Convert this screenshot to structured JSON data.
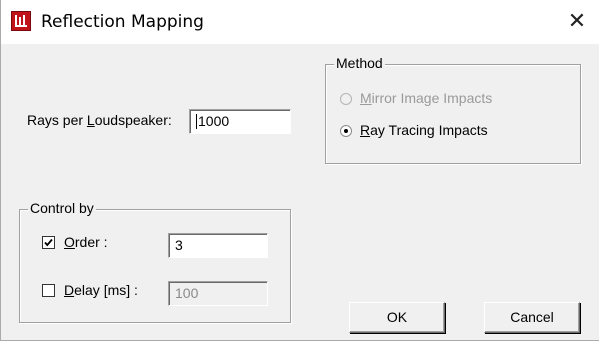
{
  "window": {
    "title": "Reflection Mapping",
    "close_glyph": "✕"
  },
  "rays": {
    "label_prefix": "Rays per ",
    "label_underlined": "L",
    "label_suffix": "oudspeaker:",
    "value": "1000"
  },
  "method": {
    "legend": "Method",
    "options": [
      {
        "underlined": "M",
        "rest": "irror Image Impacts",
        "selected": false,
        "enabled": false
      },
      {
        "underlined": "R",
        "rest": "ay Tracing Impacts",
        "selected": true,
        "enabled": true
      }
    ]
  },
  "control_by": {
    "legend": "Control by",
    "order": {
      "underlined": "O",
      "rest": "rder :",
      "checked": true,
      "value": "3"
    },
    "delay": {
      "underlined": "D",
      "rest": "elay [ms] :",
      "checked": false,
      "value": "100"
    }
  },
  "buttons": {
    "ok": "OK",
    "cancel": "Cancel"
  }
}
